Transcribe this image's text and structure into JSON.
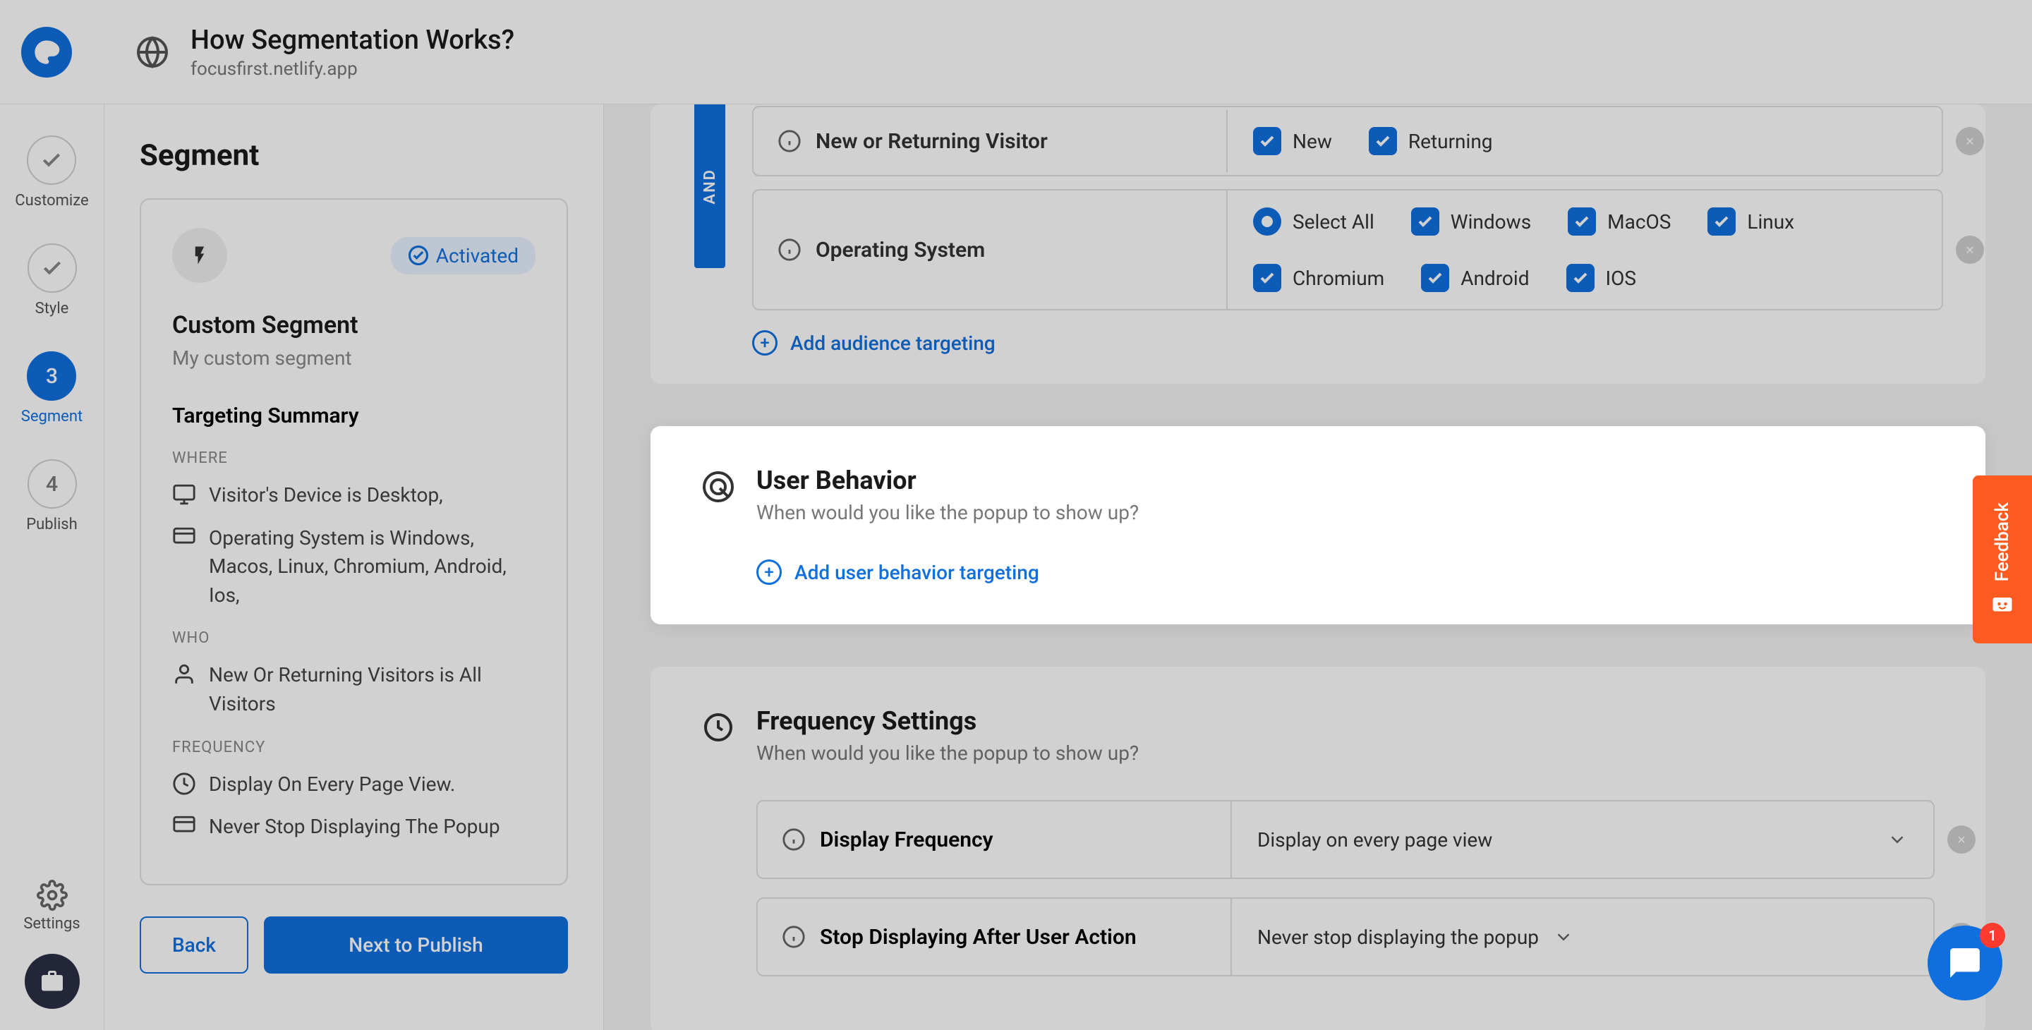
{
  "header": {
    "title": "How Segmentation Works?",
    "subtitle": "focusfirst.netlify.app"
  },
  "rail": {
    "steps": [
      {
        "label": "Customize"
      },
      {
        "label": "Style"
      },
      {
        "number": "3",
        "label": "Segment"
      },
      {
        "number": "4",
        "label": "Publish"
      }
    ],
    "settings": "Settings"
  },
  "segment_panel": {
    "title": "Segment",
    "activated": "Activated",
    "card_heading": "Custom Segment",
    "card_sub": "My custom segment",
    "summary_heading": "Targeting Summary",
    "where_label": "WHERE",
    "where_line1": "Visitor's Device is Desktop,",
    "where_line2": "Operating System is Windows, Macos, Linux, Chromium, Android, Ios,",
    "who_label": "WHO",
    "who_line1": "New Or Returning Visitors is All Visitors",
    "freq_label": "FREQUENCY",
    "freq_line1": "Display On Every Page View.",
    "freq_line2": "Never Stop Displaying The Popup",
    "back": "Back",
    "next": "Next to Publish"
  },
  "audience": {
    "and_label": "AND",
    "row1_label": "New or Returning Visitor",
    "row1_opt1": "New",
    "row1_opt2": "Returning",
    "row2_label": "Operating System",
    "row2_opt1": "Select All",
    "row2_opt2": "Windows",
    "row2_opt3": "MacOS",
    "row2_opt4": "Linux",
    "row2_opt5": "Chromium",
    "row2_opt6": "Android",
    "row2_opt7": "IOS",
    "add_link": "Add audience targeting"
  },
  "behavior": {
    "title": "User Behavior",
    "desc": "When would you like the popup to show up?",
    "add_link": "Add user behavior targeting"
  },
  "frequency": {
    "title": "Frequency Settings",
    "desc": "When would you like the popup to show up?",
    "row1_label": "Display Frequency",
    "row1_value": "Display on every page view",
    "row2_label": "Stop Displaying After User Action",
    "row2_value": "Never stop displaying the popup"
  },
  "feedback": "Feedback",
  "chat_badge": "1"
}
